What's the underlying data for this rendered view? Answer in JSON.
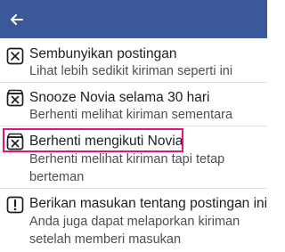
{
  "header": {
    "back_icon": "arrow-left-icon",
    "background_color": "#3b5998"
  },
  "menu": {
    "items": [
      {
        "icon": "x-box-icon",
        "title": "Sembunyikan postingan",
        "description": "Lihat lebih sedikit kiriman seperti ini"
      },
      {
        "icon": "snooze-box-icon",
        "title": "Snooze Novia selama 30 hari",
        "description": "Berhenti melihat kiriman sementara"
      },
      {
        "icon": "unfollow-box-icon",
        "title": "Berhenti mengikuti Novia",
        "description": "Berhenti melihat kiriman tapi tetap berteman",
        "highlighted": true
      },
      {
        "icon": "exclamation-box-icon",
        "title": "Berikan masukan tentang postingan ini",
        "description": "Anda juga dapat melaporkan kiriman setelah memberi masukan"
      }
    ]
  },
  "colors": {
    "highlight": "#e0137f",
    "divider": "#dddfe2"
  }
}
